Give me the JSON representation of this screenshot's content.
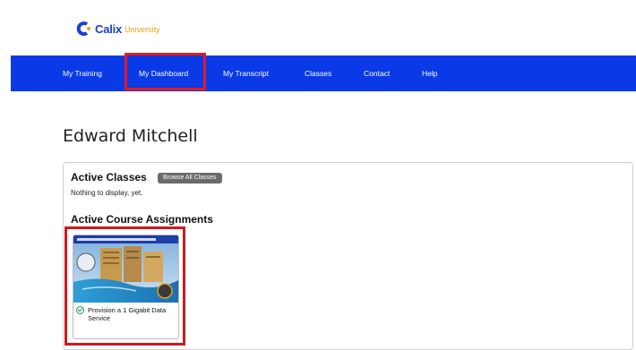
{
  "logo": {
    "brand": "Calix",
    "sub": "University"
  },
  "nav": {
    "items": [
      {
        "label": "My Training"
      },
      {
        "label": "My Dashboard"
      },
      {
        "label": "My Transcript"
      },
      {
        "label": "Classes"
      },
      {
        "label": "Contact"
      },
      {
        "label": "Help"
      }
    ]
  },
  "user": {
    "name": "Edward Mitchell"
  },
  "active_classes": {
    "title": "Active Classes",
    "browse_label": "Browse All Classes",
    "empty_text": "Nothing to display, yet."
  },
  "assignments": {
    "title": "Active Course Assignments",
    "course": {
      "title": "Provision a 1 Gigabit Data Service",
      "status": "complete"
    }
  },
  "colors": {
    "nav_bg": "#0a3ae6",
    "highlight": "#e01b24",
    "brand": "#1b3fd4",
    "accent": "#e9a21b"
  }
}
